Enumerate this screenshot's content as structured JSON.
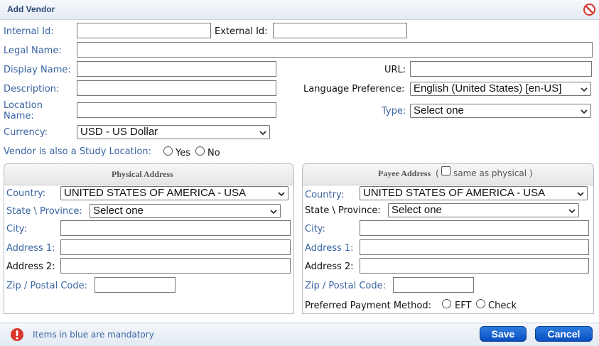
{
  "dialog": {
    "title": "Add Vendor"
  },
  "labels": {
    "internal_id": "Internal Id:",
    "external_id": "External Id:",
    "legal_name": "Legal Name:",
    "display_name": "Display Name:",
    "url": "URL:",
    "description": "Description:",
    "language_preference": "Language Preference:",
    "location_name_1": "Location",
    "location_name_2": "Name:",
    "type": "Type:",
    "currency": "Currency:",
    "study_location": "Vendor is also a Study Location:",
    "yes": "Yes",
    "no": "No"
  },
  "fields": {
    "internal_id": "",
    "external_id": "",
    "legal_name": "",
    "display_name": "",
    "url": "",
    "description": "",
    "location_name": ""
  },
  "selects": {
    "language_preference": "English (United States) [en-US]",
    "type": "Select one",
    "currency": "USD - US Dollar"
  },
  "physical_address": {
    "title": "Physical Address",
    "country_label": "Country:",
    "country_value": "UNITED STATES OF AMERICA - USA",
    "state_label": "State \\ Province:",
    "state_value": "Select one",
    "city_label": "City:",
    "address1_label": "Address 1:",
    "address2_label": "Address 2:",
    "zip_label": "Zip / Postal Code:"
  },
  "payee_address": {
    "title": "Payee Address",
    "paren_open": "(",
    "same_as_physical": "same as physical )",
    "country_label": "Country:",
    "country_value": "UNITED STATES OF AMERICA - USA",
    "state_label": "State \\ Province:",
    "state_value": "Select one",
    "city_label": "City:",
    "address1_label": "Address 1:",
    "address2_label": "Address 2:",
    "zip_label": "Zip / Postal Code:",
    "payment_method_label": "Preferred Payment Method:",
    "eft": "EFT",
    "check": "Check"
  },
  "footer": {
    "mandatory_note": "Items in blue are mandatory",
    "save": "Save",
    "cancel": "Cancel"
  },
  "colors": {
    "mandatory_label": "#3a64a3",
    "button": "#1565d8",
    "close_icon": "#d9352b"
  },
  "icons": {
    "close": "close-icon",
    "warning": "warning-icon",
    "caret": "chevron-down-icon"
  }
}
